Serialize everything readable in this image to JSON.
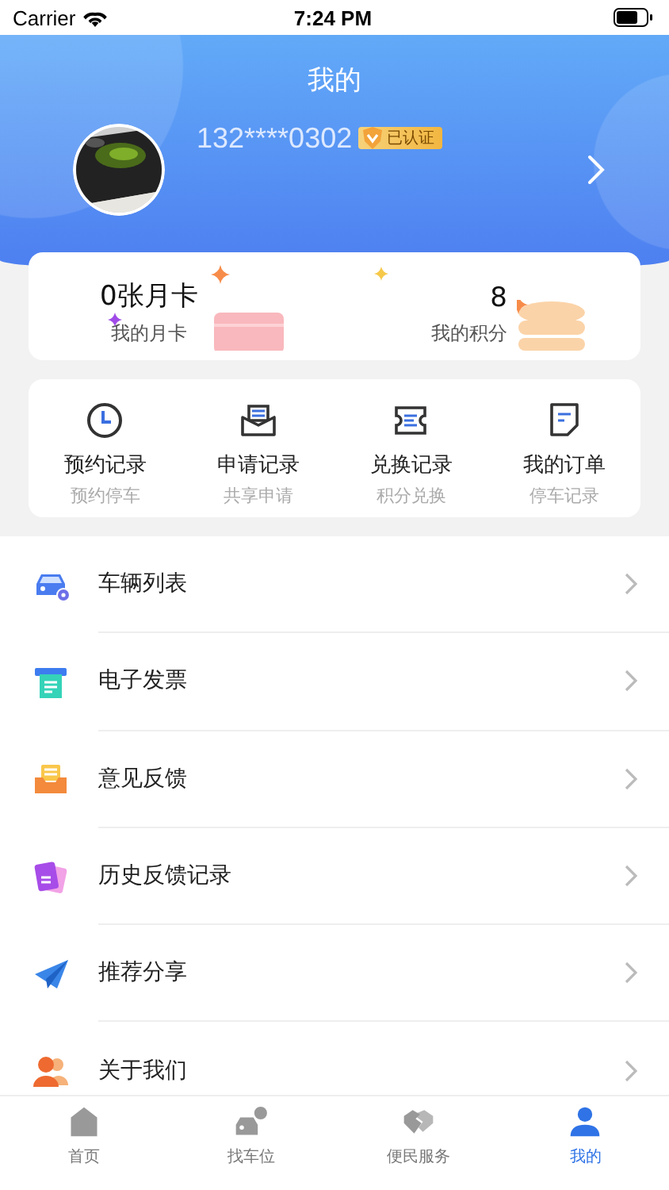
{
  "status_bar": {
    "carrier": "Carrier",
    "time": "7:24 PM"
  },
  "header": {
    "title": "我的"
  },
  "profile": {
    "phone": "132****0302",
    "badge": "已认证"
  },
  "stats": [
    {
      "value": "0张月卡",
      "label": "我的月卡",
      "kind": "card"
    },
    {
      "value": "8",
      "label": "我的积分",
      "kind": "points"
    }
  ],
  "shortcuts": [
    {
      "title": "预约记录",
      "subtitle": "预约停车",
      "kind": "clock"
    },
    {
      "title": "申请记录",
      "subtitle": "共享申请",
      "kind": "mail"
    },
    {
      "title": "兑换记录",
      "subtitle": "积分兑换",
      "kind": "ticket"
    },
    {
      "title": "我的订单",
      "subtitle": "停车记录",
      "kind": "order"
    }
  ],
  "menu": [
    {
      "label": "车辆列表",
      "kind": "car"
    },
    {
      "label": "电子发票",
      "kind": "invoice"
    },
    {
      "label": "意见反馈",
      "kind": "feedback"
    },
    {
      "label": "历史反馈记录",
      "kind": "history"
    },
    {
      "label": "推荐分享",
      "kind": "share"
    },
    {
      "label": "关于我们",
      "kind": "about"
    }
  ],
  "tab_bar": [
    {
      "label": "首页",
      "kind": "home",
      "selected": false
    },
    {
      "label": "找车位",
      "kind": "parking",
      "selected": false
    },
    {
      "label": "便民服务",
      "kind": "service",
      "selected": false
    },
    {
      "label": "我的",
      "kind": "me",
      "selected": true
    }
  ]
}
